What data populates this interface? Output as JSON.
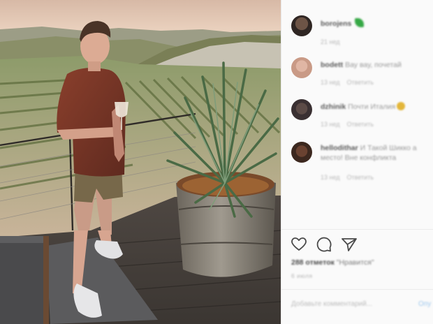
{
  "post": {
    "comments": [
      {
        "user": "borojens",
        "text": "",
        "emoji": "leaf",
        "time": "21 нед",
        "likes": "",
        "reply": ""
      },
      {
        "user": "bodett",
        "text": "Вау вау, почетай",
        "emoji": "",
        "time": "13 нед",
        "likes": "",
        "reply": "Ответить"
      },
      {
        "user": "dzhinik",
        "text": "Почти Италия",
        "emoji": "face",
        "time": "13 нед",
        "likes": "",
        "reply": "Ответить"
      },
      {
        "user": "hellodithar",
        "text": "И Такой Шикко а место! Вне конфликта",
        "emoji": "",
        "time": "13 нед",
        "likes": "",
        "reply": "Ответить"
      }
    ],
    "likes_count": "288 отметок",
    "likes_suffix": "\"Нравится\"",
    "date": "6 июля",
    "add_comment_placeholder": "Добавьте комментарий...",
    "post_button": "Опу"
  },
  "icons": {
    "like": "heart-icon",
    "comment": "comment-icon",
    "share": "share-icon"
  },
  "colors": {
    "panel_bg": "#fafafa",
    "text_muted": "#9a9a9a",
    "accent_blue": "#9fc8ee"
  }
}
